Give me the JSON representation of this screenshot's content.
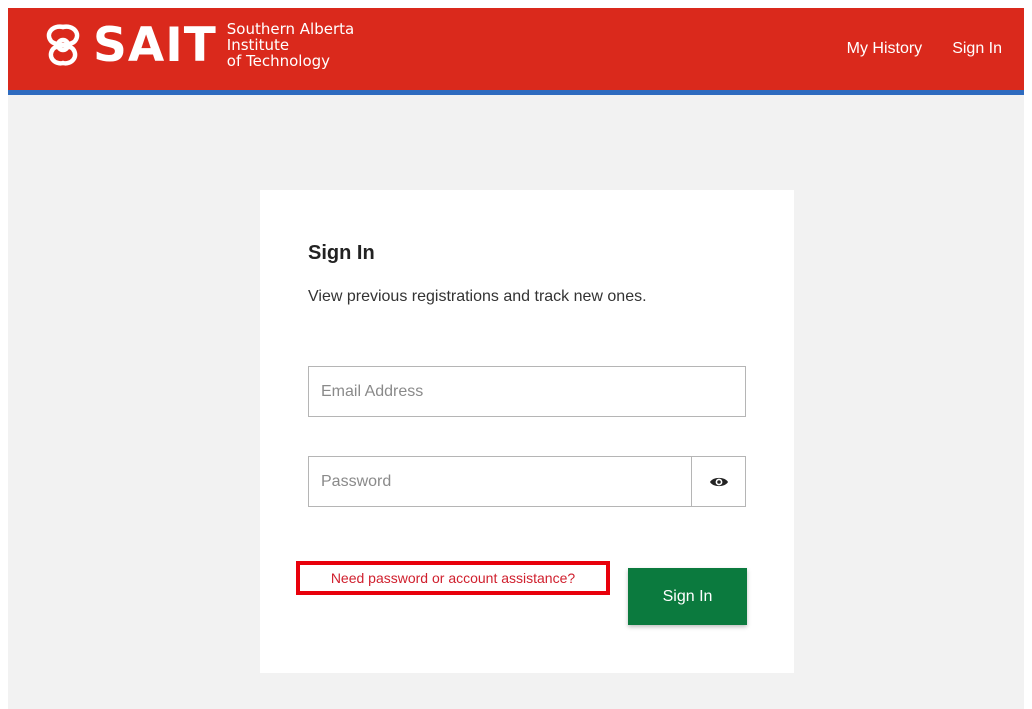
{
  "brand": {
    "name": "SAIT",
    "subtitle_lines": [
      "Southern Alberta",
      "Institute",
      "of Technology"
    ],
    "primary_color": "#da291c",
    "accent_color": "#2e6bbf"
  },
  "nav": {
    "history_label": "My History",
    "signin_label": "Sign In"
  },
  "signin": {
    "title": "Sign In",
    "subtitle": "View previous registrations and track new ones.",
    "email_placeholder": "Email Address",
    "password_placeholder": "Password",
    "show_password_icon": "eye-icon",
    "assistance_link": "Need password or account assistance?",
    "submit_label": "Sign In",
    "submit_color": "#0b7a3e",
    "highlight_color": "#e8000b"
  }
}
